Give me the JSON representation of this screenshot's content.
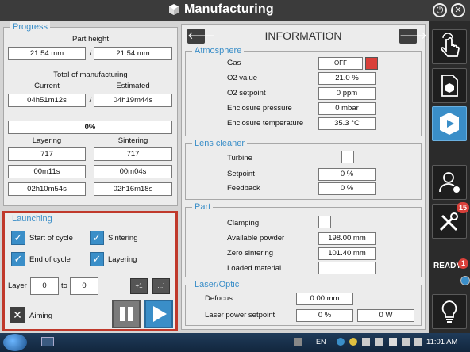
{
  "window": {
    "title": "Manufacturing"
  },
  "progress": {
    "title": "Progress",
    "part_height_label": "Part height",
    "part_height_current": "21.54 mm",
    "part_height_separator": "/",
    "part_height_total": "21.54 mm",
    "total_label": "Total of manufacturing",
    "current_label": "Current",
    "estimated_label": "Estimated",
    "current_time": "04h51m12s",
    "time_separator": "/",
    "estimated_time": "04h19m44s",
    "percent": "0%",
    "layering_label": "Layering",
    "sintering_label": "Sintering",
    "layering_count": "717",
    "sintering_count": "717",
    "layering_time1": "00m11s",
    "sintering_time1": "00m04s",
    "layering_time2": "02h10m54s",
    "sintering_time2": "02h16m18s"
  },
  "launching": {
    "title": "Launching",
    "start_of_cycle": "Start of cycle",
    "sintering": "Sintering",
    "end_of_cycle": "End of cycle",
    "layering": "Layering",
    "layer_label": "Layer",
    "layer_from": "0",
    "to_label": "to",
    "layer_to": "0",
    "plus_one": "+1",
    "more": "...]",
    "aiming_label": "Aiming"
  },
  "information": {
    "title": "INFORMATION",
    "atmosphere": {
      "title": "Atmosphere",
      "gas_label": "Gas",
      "gas_value": "OFF",
      "o2_value_label": "O2 value",
      "o2_value": "21.0 %",
      "o2_setpoint_label": "O2 setpoint",
      "o2_setpoint": "0 ppm",
      "pressure_label": "Enclosure pressure",
      "pressure": "0 mbar",
      "temp_label": "Enclosure temperature",
      "temp": "35.3 °C"
    },
    "lens": {
      "title": "Lens cleaner",
      "turbine_label": "Turbine",
      "setpoint_label": "Setpoint",
      "setpoint": "0 %",
      "feedback_label": "Feedback",
      "feedback": "0 %"
    },
    "part": {
      "title": "Part",
      "clamping_label": "Clamping",
      "powder_label": "Available powder",
      "powder": "198.00 mm",
      "zero_label": "Zero sintering",
      "zero": "101.40 mm",
      "material_label": "Loaded material",
      "material": ""
    },
    "laser": {
      "title": "Laser/Optic",
      "defocus_label": "Defocus",
      "defocus": "0.00 mm",
      "power_label": "Laser power setpoint",
      "power_pct": "0 %",
      "power_w": "0 W"
    }
  },
  "sidebar": {
    "ready_label": "READY",
    "ready_count": "1",
    "tools_badge": "15"
  },
  "taskbar": {
    "language": "EN",
    "time": "11:01 AM"
  },
  "colors": {
    "accent": "#3a8ec8",
    "launch_border": "#c0392b",
    "gas_off": "#d9403a"
  }
}
